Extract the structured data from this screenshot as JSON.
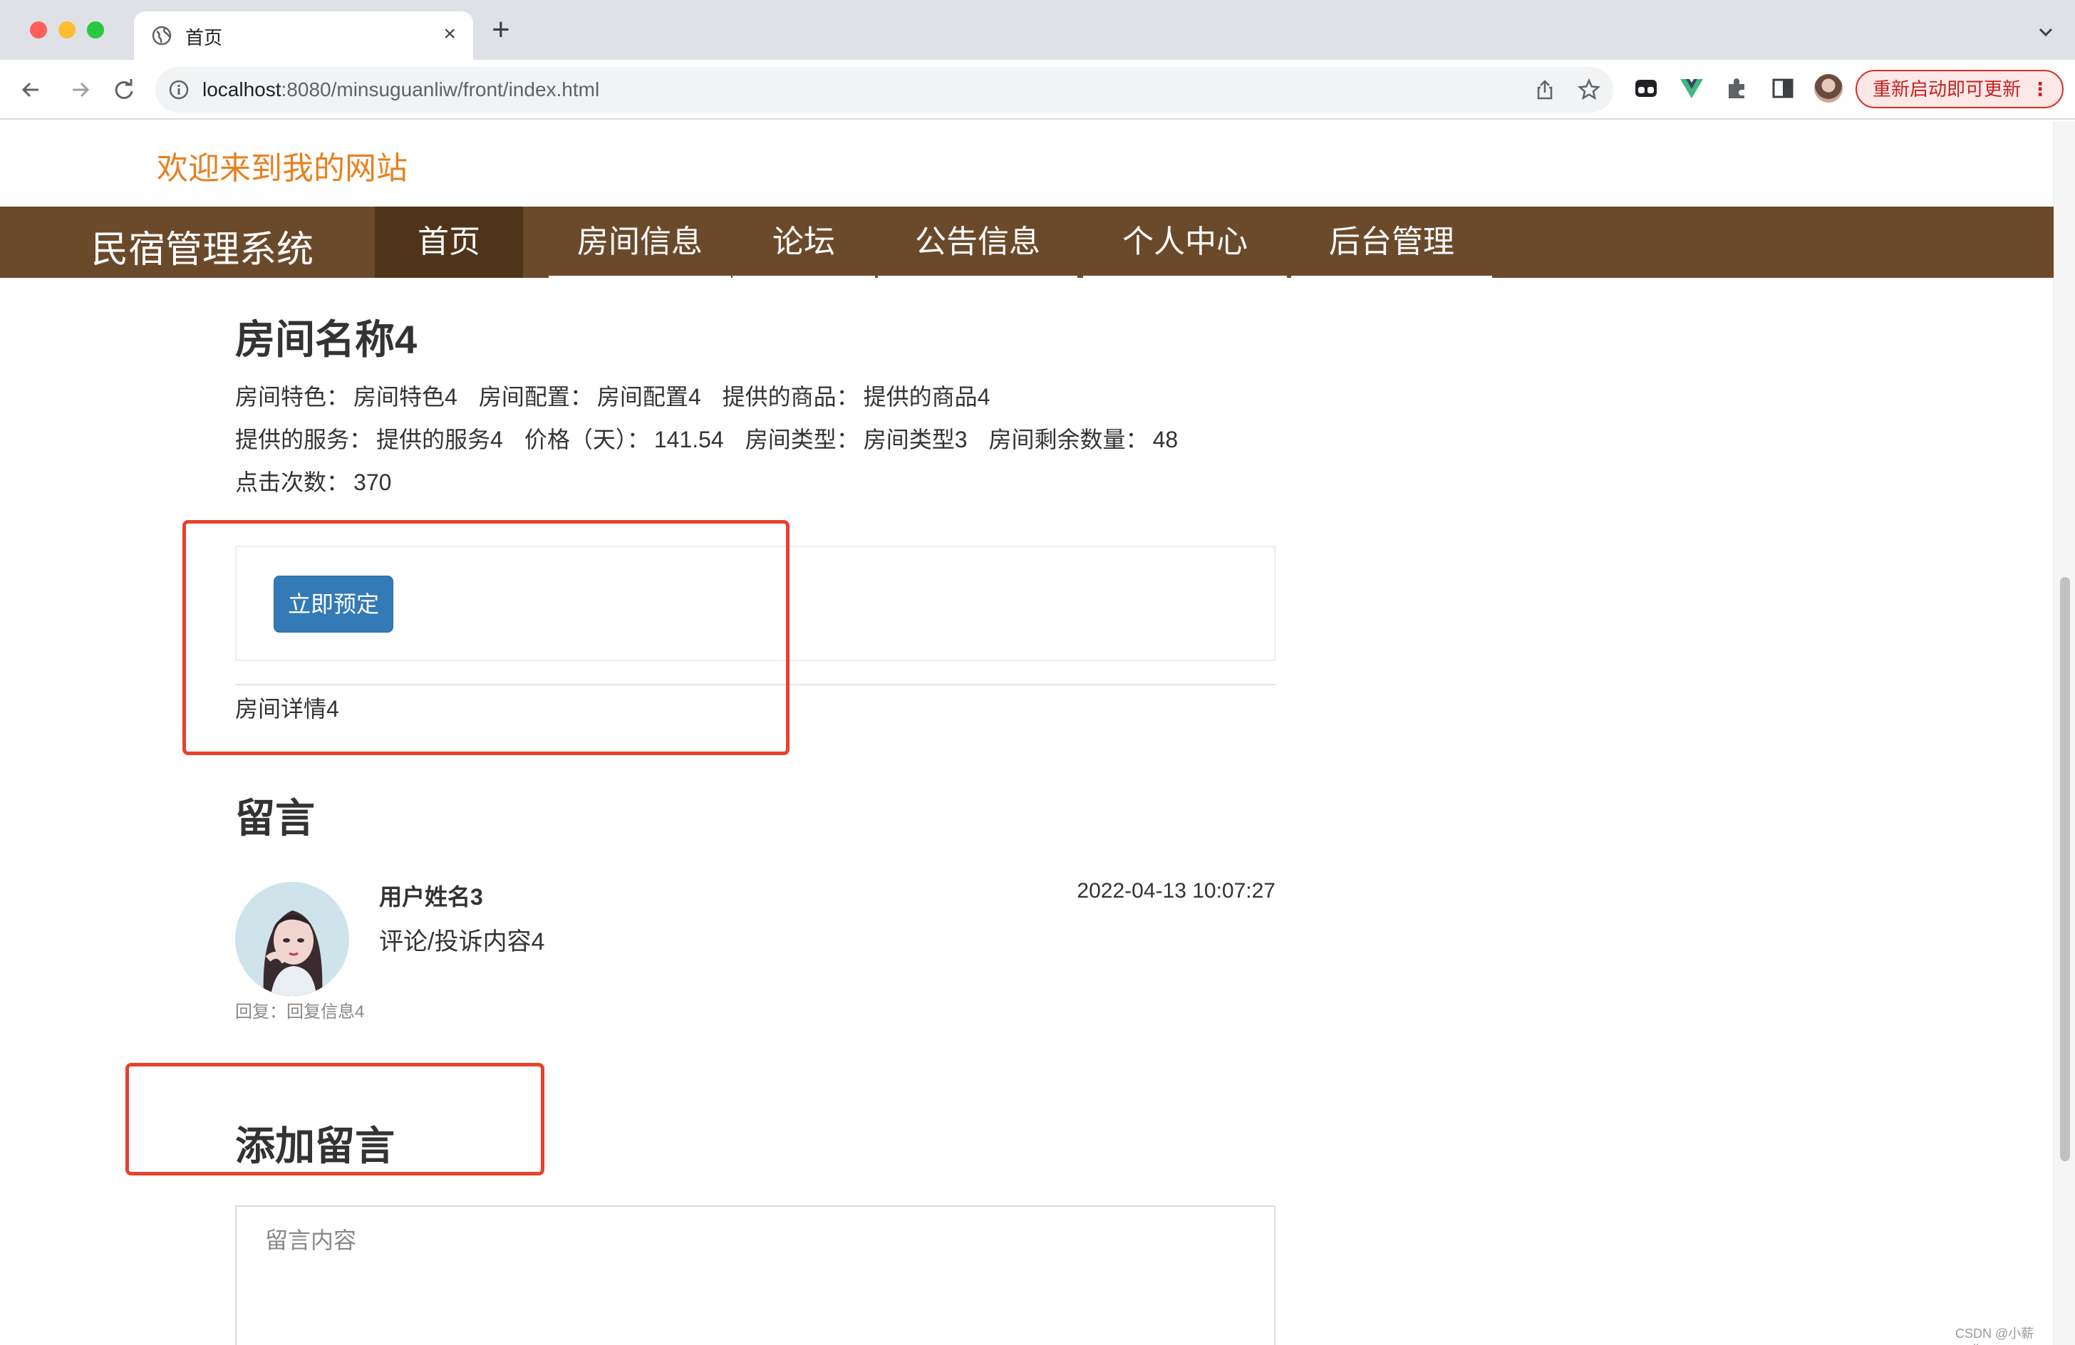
{
  "browser": {
    "tab_title": "首页",
    "tab_close": "×",
    "new_tab": "+",
    "url_host": "localhost",
    "url_rest": ":8080/minsuguanliw/front/index.html",
    "update_label": "重新启动即可更新",
    "update_menu": "⋮"
  },
  "site": {
    "welcome": "欢迎来到我的网站",
    "brand": "民宿管理系统",
    "nav": [
      "首页",
      "房间信息",
      "论坛",
      "公告信息",
      "个人中心",
      "后台管理"
    ],
    "active_nav_index": 0,
    "accent_color": "#6b4a2b",
    "welcome_color": "#e8801f"
  },
  "room": {
    "name": "房间名称4",
    "feature_label": "房间特色：",
    "feature_value": "房间特色4",
    "config_label": "房间配置：",
    "config_value": "房间配置4",
    "goods_label": "提供的商品：",
    "goods_value": "提供的商品4",
    "service_label": "提供的服务：",
    "service_value": "提供的服务4",
    "price_label": "价格（天）：",
    "price_value": "141.54",
    "type_label": "房间类型：",
    "type_value": "房间类型3",
    "remaining_label": "房间剩余数量：",
    "remaining_value": "48",
    "clicks_label": "点击次数：",
    "clicks_value": "370",
    "book_button": "立即预定",
    "detail": "房间详情4"
  },
  "comments": {
    "title": "留言",
    "items": [
      {
        "user": "用户姓名3",
        "time": "2022-04-13 10:07:27",
        "content": "评论/投诉内容4",
        "reply": "回复：回复信息4"
      }
    ]
  },
  "add_comment": {
    "title": "添加留言",
    "placeholder": "留言内容"
  },
  "watermark": "CSDN @小薪coding"
}
